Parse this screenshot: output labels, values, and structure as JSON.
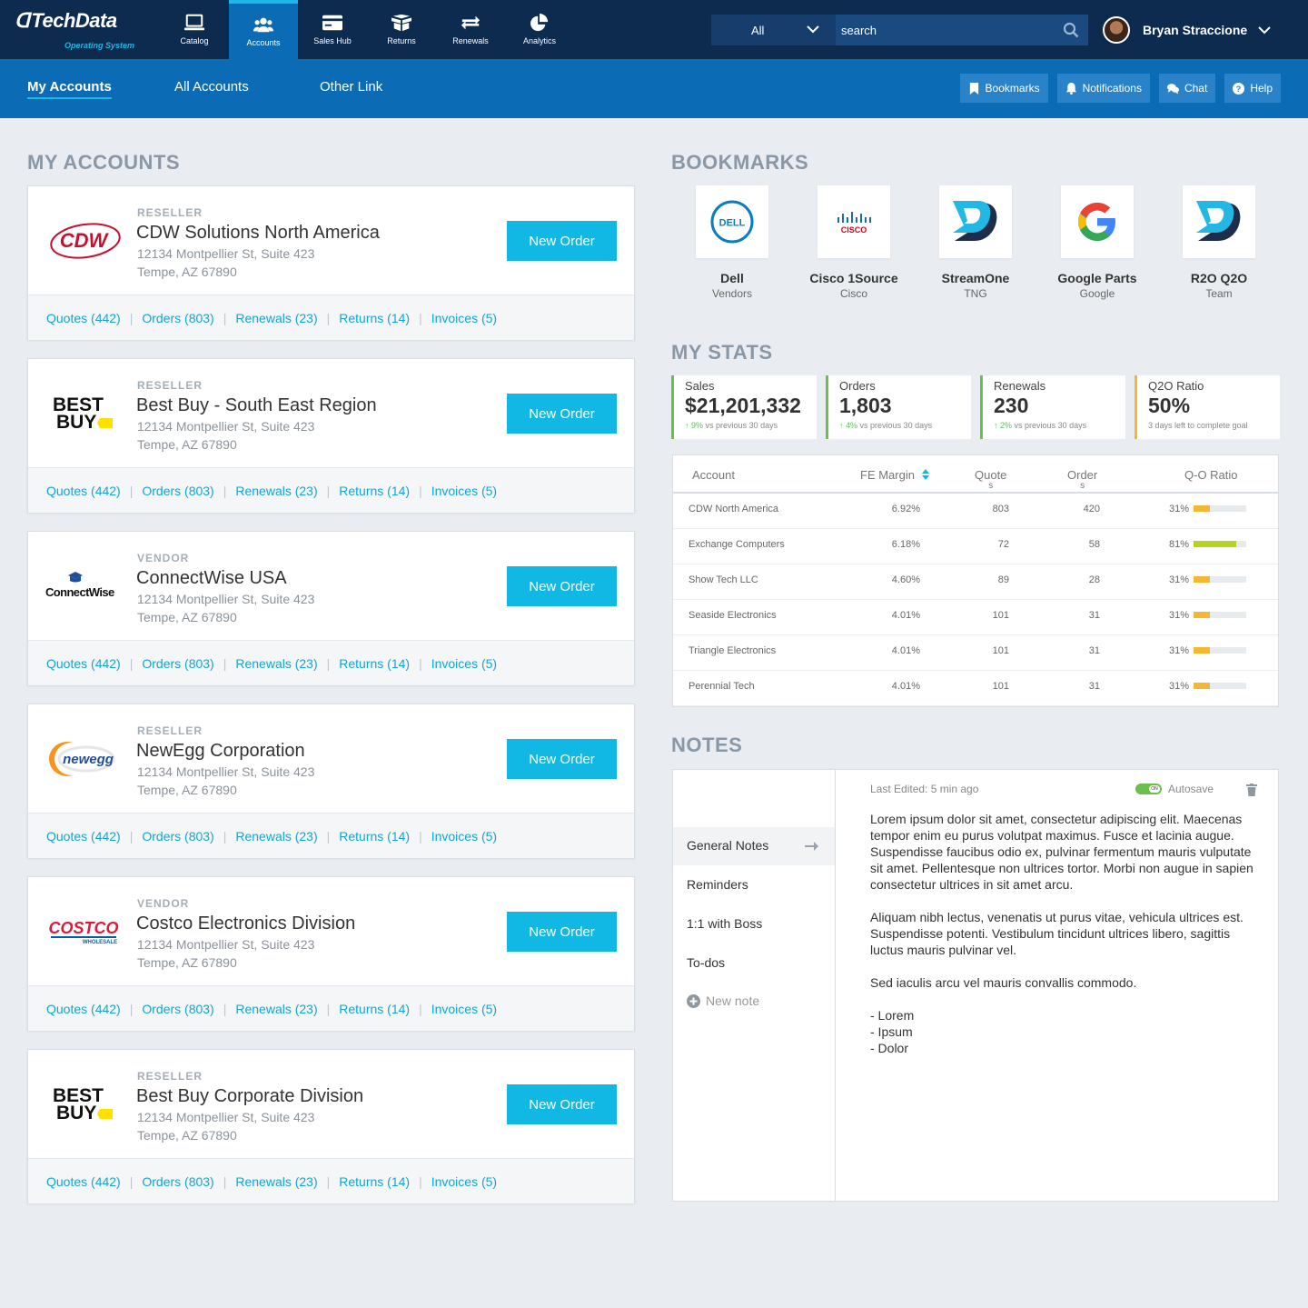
{
  "brand": {
    "name": "TechData",
    "tagline": "Operating System"
  },
  "nav": [
    {
      "label": "Catalog",
      "icon": "laptop-icon",
      "active": false
    },
    {
      "label": "Accounts",
      "icon": "users-icon",
      "active": true
    },
    {
      "label": "Sales Hub",
      "icon": "card-icon",
      "active": false
    },
    {
      "label": "Returns",
      "icon": "box-icon",
      "active": false
    },
    {
      "label": "Renewals",
      "icon": "repeat-icon",
      "active": false
    },
    {
      "label": "Analytics",
      "icon": "pie-icon",
      "active": false
    }
  ],
  "search": {
    "scope": "All",
    "placeholder": "search"
  },
  "user": {
    "name": "Bryan Straccione"
  },
  "subnav": {
    "tabs": [
      "My Accounts",
      "All Accounts",
      "Other Link"
    ],
    "active": "My Accounts"
  },
  "quick_buttons": [
    "Bookmarks",
    "Notifications",
    "Chat",
    "Help"
  ],
  "sections": {
    "accounts": "MY ACCOUNTS",
    "bookmarks": "BOOKMARKS",
    "stats": "MY STATS",
    "notes": "NOTES"
  },
  "account_links": [
    "Quotes (442)",
    "Orders (803)",
    "Renewals (23)",
    "Returns (14)",
    "Invoices (5)"
  ],
  "new_order_label": "New Order",
  "accounts": [
    {
      "type": "RESELLER",
      "name": "CDW Solutions North America",
      "addr1": "12134 Montpellier St, Suite 423",
      "addr2": "Tempe, AZ 67890",
      "logo": "cdw"
    },
    {
      "type": "RESELLER",
      "name": "Best Buy - South East Region",
      "addr1": "12134 Montpellier St, Suite 423",
      "addr2": "Tempe, AZ 67890",
      "logo": "bestbuy"
    },
    {
      "type": "VENDOR",
      "name": "ConnectWise USA",
      "addr1": "12134 Montpellier St, Suite 423",
      "addr2": "Tempe, AZ 67890",
      "logo": "connectwise"
    },
    {
      "type": "RESELLER",
      "name": "NewEgg Corporation",
      "addr1": "12134 Montpellier St, Suite 423",
      "addr2": "Tempe, AZ 67890",
      "logo": "newegg"
    },
    {
      "type": "VENDOR",
      "name": "Costco Electronics Division",
      "addr1": "12134 Montpellier St, Suite 423",
      "addr2": "Tempe, AZ 67890",
      "logo": "costco"
    },
    {
      "type": "RESELLER",
      "name": "Best Buy Corporate Division",
      "addr1": "12134 Montpellier St, Suite 423",
      "addr2": "Tempe, AZ 67890",
      "logo": "bestbuy"
    }
  ],
  "logos": {
    "cdw": "CDW",
    "bestbuy_1": "BEST",
    "bestbuy_2": "BUY",
    "connectwise": "ConnectWise",
    "newegg": "newegg",
    "costco": "COSTCO",
    "costco_sub": "WHOLESALE",
    "dell": "DELL",
    "cisco": "CISCO"
  },
  "bookmarks": [
    {
      "name": "Dell",
      "sub": "Vendors",
      "logo": "dell"
    },
    {
      "name": "Cisco 1Source",
      "sub": "Cisco",
      "logo": "cisco"
    },
    {
      "name": "StreamOne",
      "sub": "TNG",
      "logo": "techdata"
    },
    {
      "name": "Google Parts",
      "sub": "Google",
      "logo": "google"
    },
    {
      "name": "R2O Q2O",
      "sub": "Team",
      "logo": "techdata"
    }
  ],
  "stats": [
    {
      "label": "Sales",
      "value": "$21,201,332",
      "delta": "9%",
      "note": "vs previous 30 days",
      "color": "#6dbf4b"
    },
    {
      "label": "Orders",
      "value": "1,803",
      "delta": "4%",
      "note": "vs previous 30 days",
      "color": "#6dbf4b"
    },
    {
      "label": "Renewals",
      "value": "230",
      "delta": "2%",
      "note": "vs previous 30 days",
      "color": "#6dbf4b"
    },
    {
      "label": "Q2O Ratio",
      "value": "50%",
      "delta": "",
      "note": "3 days left to complete goal",
      "color": "#f5b731"
    }
  ],
  "table": {
    "headers": [
      "Account",
      "FE Margin",
      "Quote",
      "s",
      "Order",
      "s",
      "Q-O Ratio"
    ],
    "rows": [
      {
        "account": "CDW North America",
        "margin": "6.92%",
        "quotes": "803",
        "orders": "420",
        "ratio": "31%",
        "fill": 0.31,
        "color": "#f5b731"
      },
      {
        "account": "Exchange Computers",
        "margin": "6.18%",
        "quotes": "72",
        "orders": "58",
        "ratio": "81%",
        "fill": 0.81,
        "color": "#b6d323"
      },
      {
        "account": "Show Tech LLC",
        "margin": "4.60%",
        "quotes": "89",
        "orders": "28",
        "ratio": "31%",
        "fill": 0.31,
        "color": "#f5b731"
      },
      {
        "account": "Seaside Electronics",
        "margin": "4.01%",
        "quotes": "101",
        "orders": "31",
        "ratio": "31%",
        "fill": 0.31,
        "color": "#f5b731"
      },
      {
        "account": "Triangle Electronics",
        "margin": "4.01%",
        "quotes": "101",
        "orders": "31",
        "ratio": "31%",
        "fill": 0.31,
        "color": "#f5b731"
      },
      {
        "account": "Perennial Tech",
        "margin": "4.01%",
        "quotes": "101",
        "orders": "31",
        "ratio": "31%",
        "fill": 0.31,
        "color": "#f5b731"
      }
    ]
  },
  "notes": {
    "items": [
      "General Notes",
      "Reminders",
      "1:1 with Boss",
      "To-dos"
    ],
    "active": "General Notes",
    "new_note": "New note",
    "last_edited": "Last Edited: 5 min ago",
    "autosave": "Autosave",
    "toggle": "ON",
    "body": "Lorem ipsum dolor sit amet, consectetur adipiscing elit. Maecenas tempor enim eu purus volutpat maximus. Fusce et lacinia augue. Suspendisse faucibus odio ex, pulvinar fermentum mauris vulputate sit amet. Pellentesque non ultrices tortor. Morbi non augue in sapien consectetur ultrices in sit amet arcu.\n\nAliquam nibh lectus, venenatis ut purus vitae, vehicula ultrices est. Suspendisse potenti. Vestibulum tincidunt ultrices libero, sagittis luctus mauris pulvinar vel.\n\nSed iaculis arcu vel mauris convallis commodo.\n\n- Lorem\n- Ipsum\n- Dolor"
  },
  "colors": {
    "header": "#0d2a4f",
    "subnav": "#0b6bb5",
    "accent": "#12b8e4",
    "link": "#12a5d6"
  }
}
